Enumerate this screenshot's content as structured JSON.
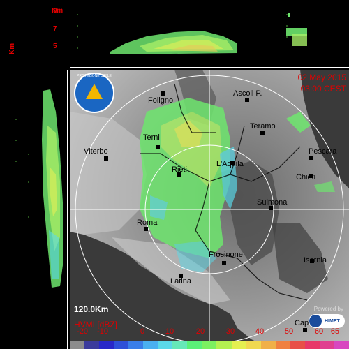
{
  "side_panels": {
    "top_km_unit": "Km",
    "left_km_unit": "Km",
    "height_ticks": [
      "9",
      "7",
      "5"
    ]
  },
  "map": {
    "date": "02 May 2015",
    "time": "03:00 CEST",
    "range_label": "120.0Km",
    "product_label": "HVMI [dBZ]",
    "powered_by": "Powered by",
    "provider": "HIMET",
    "logo_text": "PROTEZIONE CIVILE",
    "cities": [
      {
        "name": "Foligno"
      },
      {
        "name": "Ascoli P."
      },
      {
        "name": "Teramo"
      },
      {
        "name": "Terni"
      },
      {
        "name": "Viterbo"
      },
      {
        "name": "Pescara"
      },
      {
        "name": "Rieti"
      },
      {
        "name": "L'Aquila"
      },
      {
        "name": "Chieti"
      },
      {
        "name": "Sulmona"
      },
      {
        "name": "Roma"
      },
      {
        "name": "Frosinone"
      },
      {
        "name": "Isernia"
      },
      {
        "name": "Latina"
      },
      {
        "name": "Capua"
      }
    ]
  },
  "color_scale": {
    "labels": [
      "-20",
      "-10",
      "0",
      "10",
      "20",
      "30",
      "40",
      "50",
      "60",
      "65"
    ],
    "colors": [
      "#8c8c8c",
      "#3c3c9c",
      "#2828c8",
      "#2e50d8",
      "#3a7ee8",
      "#4ab0f0",
      "#5ad8e8",
      "#66e8b8",
      "#5af078",
      "#7cf060",
      "#b4f050",
      "#e4f050",
      "#f0d850",
      "#f0b048",
      "#f08040",
      "#e85048",
      "#e83868",
      "#e04090",
      "#d848c0"
    ]
  }
}
